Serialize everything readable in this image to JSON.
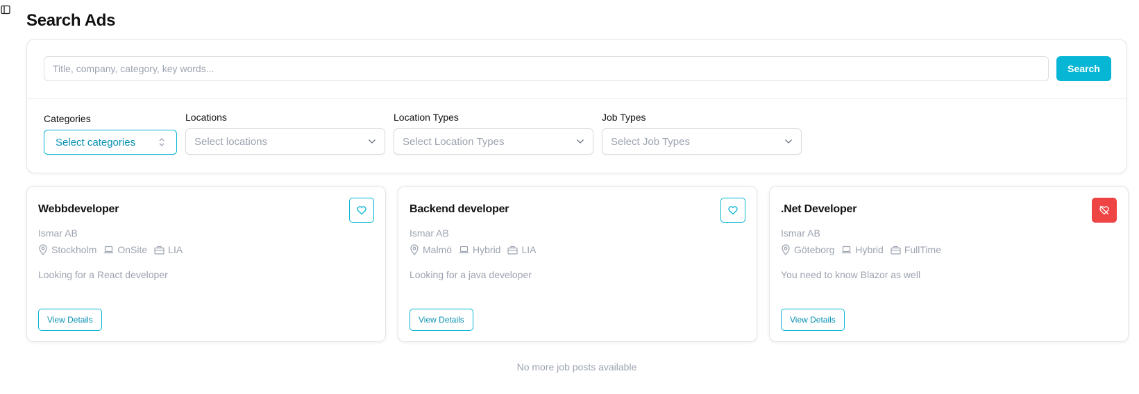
{
  "page": {
    "title": "Search Ads"
  },
  "search": {
    "placeholder": "Title, company, category, key words...",
    "button_label": "Search"
  },
  "filters": {
    "categories": {
      "label": "Categories",
      "value": "Select categories"
    },
    "locations": {
      "label": "Locations",
      "placeholder": "Select locations"
    },
    "location_types": {
      "label": "Location Types",
      "placeholder": "Select Location Types"
    },
    "job_types": {
      "label": "Job Types",
      "placeholder": "Select Job Types"
    }
  },
  "jobs": [
    {
      "title": "Webbdeveloper",
      "company": "Ismar AB",
      "location": "Stockholm",
      "location_type": "OnSite",
      "job_type": "LIA",
      "description": "Looking for a React developer",
      "favorited": false,
      "button_label": "View Details"
    },
    {
      "title": "Backend developer",
      "company": "Ismar AB",
      "location": "Malmö",
      "location_type": "Hybrid",
      "job_type": "LIA",
      "description": "Looking for a java developer",
      "favorited": false,
      "button_label": "View Details"
    },
    {
      "title": ".Net Developer",
      "company": "Ismar AB",
      "location": "Göteborg",
      "location_type": "Hybrid",
      "job_type": "FullTime",
      "description": "You need to know Blazor as well",
      "favorited": true,
      "button_label": "View Details"
    }
  ],
  "footer": {
    "message": "No more job posts available"
  },
  "colors": {
    "accent": "#06b6d4",
    "favorite_active": "#ef4444",
    "muted_text": "#9ca3af"
  }
}
